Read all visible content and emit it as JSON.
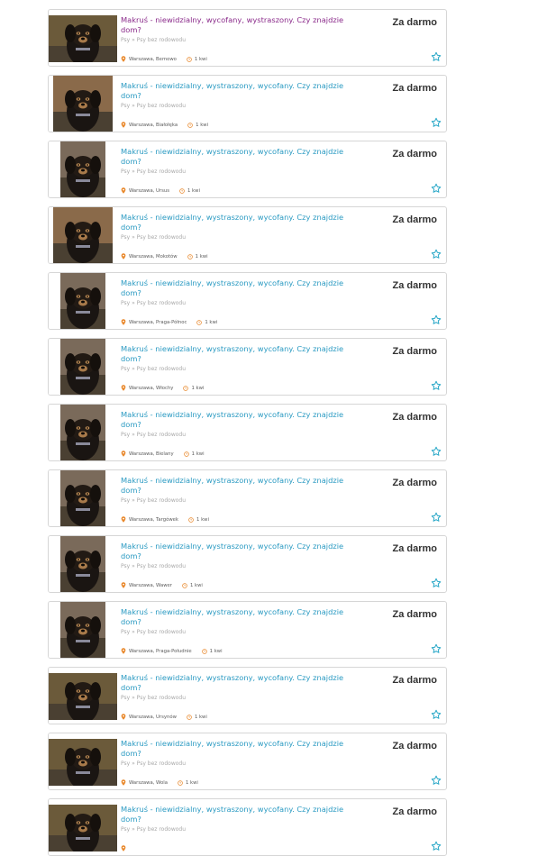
{
  "listing": {
    "title": "Makruś - niewidzialny, wystraszony, wycofany. Czy znajdzie dom?",
    "title_first": "Makruś - niewidzialny, wycofany, wystraszony. Czy znajdzie dom?",
    "category": "Psy » Psy bez rodowodu",
    "price": "Za darmo",
    "date": "1 kwi"
  },
  "items": [
    {
      "location": "Warszawa, Bemowo",
      "visited": true,
      "photo": "wide"
    },
    {
      "location": "Warszawa, Białołęka",
      "visited": false,
      "photo": "mid"
    },
    {
      "location": "Warszawa, Ursus",
      "visited": false,
      "photo": "narrow"
    },
    {
      "location": "Warszawa, Mokotów",
      "visited": false,
      "photo": "mid"
    },
    {
      "location": "Warszawa, Praga-Północ",
      "visited": false,
      "photo": "narrow"
    },
    {
      "location": "Warszawa, Włochy",
      "visited": false,
      "photo": "narrow"
    },
    {
      "location": "Warszawa, Bielany",
      "visited": false,
      "photo": "narrow"
    },
    {
      "location": "Warszawa, Targówek",
      "visited": false,
      "photo": "narrow"
    },
    {
      "location": "Warszawa, Wawer",
      "visited": false,
      "photo": "narrow"
    },
    {
      "location": "Warszawa, Praga-Południe",
      "visited": false,
      "photo": "narrow"
    },
    {
      "location": "Warszawa, Ursynów",
      "visited": false,
      "photo": "wide"
    },
    {
      "location": "Warszawa, Wola",
      "visited": false,
      "photo": "wide"
    },
    {
      "location": "",
      "visited": false,
      "photo": "wide"
    }
  ],
  "colors": {
    "link": "#2a9ac2",
    "visited_link": "#8a2a8a",
    "pin": "#e8872a",
    "star": "#2aa8c8"
  },
  "icons": {
    "location": "pin-icon",
    "date": "clock-icon",
    "observe": "star-icon"
  }
}
